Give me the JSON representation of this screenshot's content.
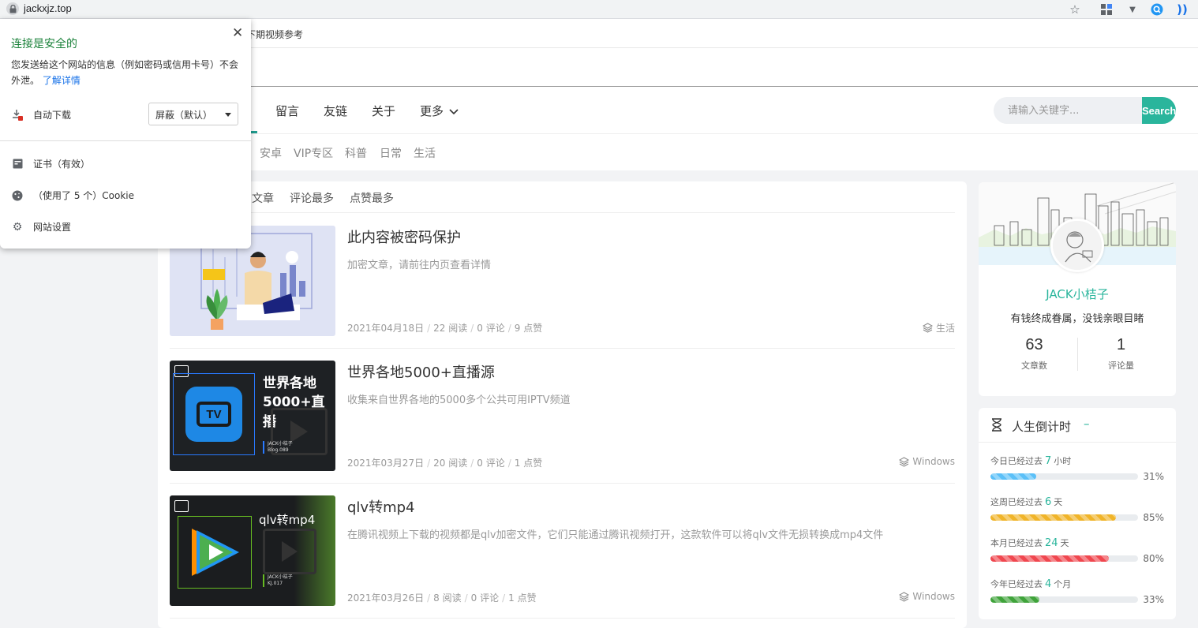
{
  "browser": {
    "url": "jackxjz.top",
    "bookmark_text": "下期视频参考"
  },
  "security_popup": {
    "title": "连接是安全的",
    "description": "您发送给这个网站的信息（例如密码或信用卡号）不会外泄。",
    "learn_more": "了解详情",
    "auto_download_label": "自动下载",
    "auto_download_value": "屏蔽（默认）",
    "certificate_label": "证书（有效）",
    "cookie_label": "（使用了 5 个）Cookie",
    "site_settings_label": "网站设置"
  },
  "nav": {
    "items": [
      "留言",
      "友链",
      "关于",
      "更多"
    ],
    "search_placeholder": "请输入关键字...",
    "search_button": "Search"
  },
  "subnav": {
    "items": [
      "安卓",
      "VIP专区",
      "科普",
      "日常",
      "生活"
    ]
  },
  "sort_tabs": [
    "文章",
    "评论最多",
    "点赞最多"
  ],
  "posts": [
    {
      "title": "此内容被密码保护",
      "excerpt": "加密文章，请前往内页查看详情",
      "date": "2021年04月18日",
      "reads": "22 阅读",
      "comments": "0 评论",
      "likes": "9 点赞",
      "category": "生活"
    },
    {
      "title": "世界各地5000+直播源",
      "excerpt": "收集来自世界各地的5000多个公共可用IPTV频道",
      "date": "2021年03月27日",
      "reads": "20 阅读",
      "comments": "0 评论",
      "likes": "1 点赞",
      "category": "Windows",
      "thumb_line1": "世界各地",
      "thumb_line2": "5000+直播",
      "thumb_small1": "JACK小桔子",
      "thumb_small2": "Blog.089"
    },
    {
      "title": "qlv转mp4",
      "excerpt": "在腾讯视频上下载的视频都是qlv加密文件，它们只能通过腾讯视频打开，这款软件可以将qlv文件无损转换成mp4文件",
      "date": "2021年03月26日",
      "reads": "8 阅读",
      "comments": "0 评论",
      "likes": "1 点赞",
      "category": "Windows",
      "thumb_line1": "qlv转mp4",
      "thumb_small1": "JACK小桔子",
      "thumb_small2": "KJ.017"
    }
  ],
  "profile": {
    "name": "JACK小桔子",
    "bio": "有钱终成眷属，没钱亲眼目睹",
    "articles_count": "63",
    "articles_label": "文章数",
    "comments_count": "1",
    "comments_label": "评论量"
  },
  "countdown": {
    "title": "人生倒计时",
    "dash": "–",
    "rows": [
      {
        "prefix": "今日已经过去",
        "num": "7",
        "unit": "小时",
        "pct_label": "31%",
        "pct": 31,
        "color": "#5bc0f8"
      },
      {
        "prefix": "这周已经过去",
        "num": "6",
        "unit": "天",
        "pct_label": "85%",
        "pct": 85,
        "color": "#f0b429"
      },
      {
        "prefix": "本月已经过去",
        "num": "24",
        "unit": "天",
        "pct_label": "80%",
        "pct": 80,
        "color": "#f0474f"
      },
      {
        "prefix": "今年已经过去",
        "num": "4",
        "unit": "个月",
        "pct_label": "33%",
        "pct": 33,
        "color": "#3fa33a"
      }
    ]
  }
}
